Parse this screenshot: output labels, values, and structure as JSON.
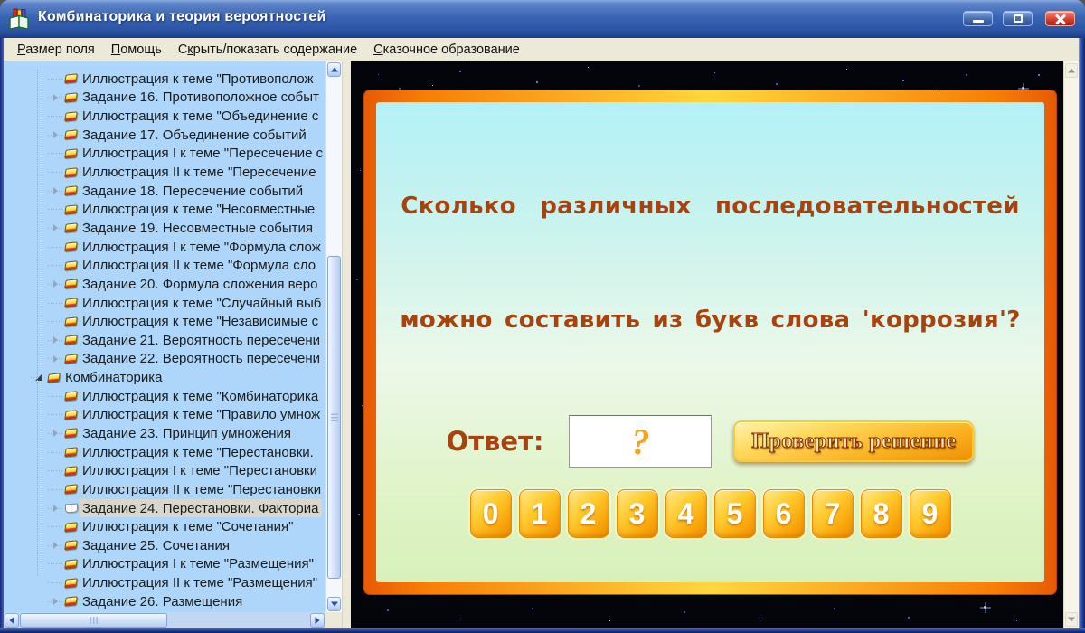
{
  "window": {
    "title": "Комбинаторика и теория вероятностей"
  },
  "menu": {
    "items": [
      {
        "pre": "",
        "key": "Р",
        "post": "азмер поля"
      },
      {
        "pre": "",
        "key": "П",
        "post": "омощь"
      },
      {
        "pre": "С",
        "key": "к",
        "post": "рыть/показать содержание"
      },
      {
        "pre": "",
        "key": "С",
        "post": "казочное образование"
      }
    ]
  },
  "tree": {
    "items": [
      {
        "label": "Иллюстрация к теме \"Противополож",
        "level": 2,
        "expandable": false,
        "expanded": false,
        "selected": false
      },
      {
        "label": "Задание 16. Противоположное событ",
        "level": 2,
        "expandable": true,
        "expanded": false,
        "selected": false
      },
      {
        "label": "Иллюстрация к теме \"Объединение с",
        "level": 2,
        "expandable": false,
        "expanded": false,
        "selected": false
      },
      {
        "label": "Задание 17. Объединение событий",
        "level": 2,
        "expandable": true,
        "expanded": false,
        "selected": false
      },
      {
        "label": "Иллюстрация I к теме \"Пересечение с",
        "level": 2,
        "expandable": false,
        "expanded": false,
        "selected": false
      },
      {
        "label": "Иллюстрация II к теме \"Пересечение",
        "level": 2,
        "expandable": false,
        "expanded": false,
        "selected": false
      },
      {
        "label": "Задание 18. Пересечение событий",
        "level": 2,
        "expandable": true,
        "expanded": false,
        "selected": false
      },
      {
        "label": "Иллюстрация к теме \"Несовместные",
        "level": 2,
        "expandable": false,
        "expanded": false,
        "selected": false
      },
      {
        "label": "Задание 19. Несовместные события",
        "level": 2,
        "expandable": true,
        "expanded": false,
        "selected": false
      },
      {
        "label": "Иллюстрация I к теме \"Формула слож",
        "level": 2,
        "expandable": false,
        "expanded": false,
        "selected": false
      },
      {
        "label": "Иллюстрация II к теме \"Формула сло",
        "level": 2,
        "expandable": false,
        "expanded": false,
        "selected": false
      },
      {
        "label": "Задание 20. Формула сложения веро",
        "level": 2,
        "expandable": true,
        "expanded": false,
        "selected": false
      },
      {
        "label": "Иллюстрация к теме \"Случайный выб",
        "level": 2,
        "expandable": false,
        "expanded": false,
        "selected": false
      },
      {
        "label": "Иллюстрация к теме \"Независимые с",
        "level": 2,
        "expandable": false,
        "expanded": false,
        "selected": false
      },
      {
        "label": "Задание 21. Вероятность пересечени",
        "level": 2,
        "expandable": true,
        "expanded": false,
        "selected": false
      },
      {
        "label": "Задание 22. Вероятность пересечени",
        "level": 2,
        "expandable": true,
        "expanded": false,
        "selected": false
      },
      {
        "label": "Комбинаторика",
        "level": 1,
        "expandable": true,
        "expanded": true,
        "selected": false
      },
      {
        "label": "Иллюстрация к теме \"Комбинаторика",
        "level": 2,
        "expandable": false,
        "expanded": false,
        "selected": false
      },
      {
        "label": "Иллюстрация к теме \"Правило умнож",
        "level": 2,
        "expandable": false,
        "expanded": false,
        "selected": false
      },
      {
        "label": "Задание 23. Принцип умножения",
        "level": 2,
        "expandable": true,
        "expanded": false,
        "selected": false
      },
      {
        "label": "Иллюстрация к теме \"Перестановки.",
        "level": 2,
        "expandable": false,
        "expanded": false,
        "selected": false
      },
      {
        "label": "Иллюстрация I к теме \"Перестановки",
        "level": 2,
        "expandable": false,
        "expanded": false,
        "selected": false
      },
      {
        "label": "Иллюстрация II к теме \"Перестановки",
        "level": 2,
        "expandable": false,
        "expanded": false,
        "selected": false
      },
      {
        "label": "Задание 24. Перестановки. Факториа",
        "level": 2,
        "expandable": true,
        "expanded": false,
        "selected": true
      },
      {
        "label": "Иллюстрация к теме \"Сочетания\"",
        "level": 2,
        "expandable": false,
        "expanded": false,
        "selected": false
      },
      {
        "label": "Задание 25. Сочетания",
        "level": 2,
        "expandable": true,
        "expanded": false,
        "selected": false
      },
      {
        "label": "Иллюстрация I к теме \"Размещения\"",
        "level": 2,
        "expandable": false,
        "expanded": false,
        "selected": false
      },
      {
        "label": "Иллюстрация II к теме \"Размещения\"",
        "level": 2,
        "expandable": false,
        "expanded": false,
        "selected": false
      },
      {
        "label": "Задание 26. Размещения",
        "level": 2,
        "expandable": true,
        "expanded": false,
        "selected": false
      }
    ]
  },
  "content": {
    "question_line1": "Сколько различных последовательностей",
    "question_line2": "можно составить из букв слова 'коррозия'?",
    "answer_label": "Ответ:",
    "answer_value": "?",
    "check_button": "Проверить решение",
    "digits": [
      "0",
      "1",
      "2",
      "3",
      "4",
      "5",
      "6",
      "7",
      "8",
      "9"
    ]
  },
  "colors": {
    "titlebar_blue": "#3a64b4",
    "menu_bg": "#ece9d8",
    "tree_bg": "#aed6fa",
    "selection_gray": "#d8d6cd",
    "frame_orange": "#f97e06",
    "frame_yellow": "#ffd83d",
    "panel_top_cyan": "#b3f1f6",
    "panel_bottom_green": "#d7f1bb",
    "question_text": "#a8430f",
    "gold_button": "#f9ae1c",
    "digit_orange": "#f9a60c",
    "close_red": "#d9473a"
  },
  "icons": {
    "app": "open-book-icon",
    "tree_node": "yellow-book-icon",
    "tree_node_selected": "open-book-icon",
    "window": [
      "minimize-icon",
      "maximize-icon",
      "close-icon"
    ]
  }
}
